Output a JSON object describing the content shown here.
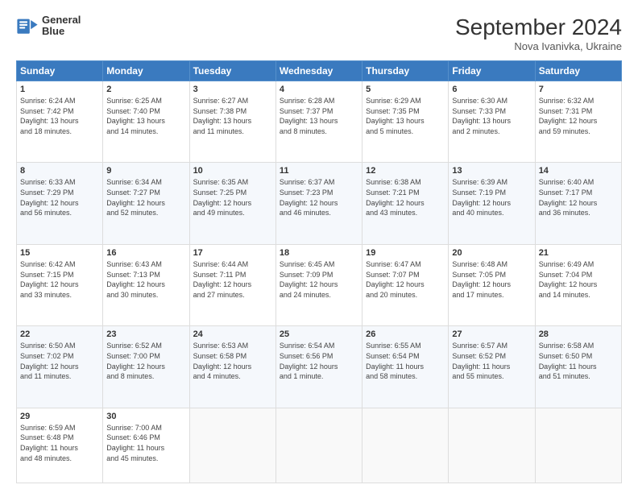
{
  "header": {
    "logo_line1": "General",
    "logo_line2": "Blue",
    "month": "September 2024",
    "location": "Nova Ivanivka, Ukraine"
  },
  "days_of_week": [
    "Sunday",
    "Monday",
    "Tuesday",
    "Wednesday",
    "Thursday",
    "Friday",
    "Saturday"
  ],
  "weeks": [
    [
      {
        "day": 1,
        "info": "Sunrise: 6:24 AM\nSunset: 7:42 PM\nDaylight: 13 hours\nand 18 minutes."
      },
      {
        "day": 2,
        "info": "Sunrise: 6:25 AM\nSunset: 7:40 PM\nDaylight: 13 hours\nand 14 minutes."
      },
      {
        "day": 3,
        "info": "Sunrise: 6:27 AM\nSunset: 7:38 PM\nDaylight: 13 hours\nand 11 minutes."
      },
      {
        "day": 4,
        "info": "Sunrise: 6:28 AM\nSunset: 7:37 PM\nDaylight: 13 hours\nand 8 minutes."
      },
      {
        "day": 5,
        "info": "Sunrise: 6:29 AM\nSunset: 7:35 PM\nDaylight: 13 hours\nand 5 minutes."
      },
      {
        "day": 6,
        "info": "Sunrise: 6:30 AM\nSunset: 7:33 PM\nDaylight: 13 hours\nand 2 minutes."
      },
      {
        "day": 7,
        "info": "Sunrise: 6:32 AM\nSunset: 7:31 PM\nDaylight: 12 hours\nand 59 minutes."
      }
    ],
    [
      {
        "day": 8,
        "info": "Sunrise: 6:33 AM\nSunset: 7:29 PM\nDaylight: 12 hours\nand 56 minutes."
      },
      {
        "day": 9,
        "info": "Sunrise: 6:34 AM\nSunset: 7:27 PM\nDaylight: 12 hours\nand 52 minutes."
      },
      {
        "day": 10,
        "info": "Sunrise: 6:35 AM\nSunset: 7:25 PM\nDaylight: 12 hours\nand 49 minutes."
      },
      {
        "day": 11,
        "info": "Sunrise: 6:37 AM\nSunset: 7:23 PM\nDaylight: 12 hours\nand 46 minutes."
      },
      {
        "day": 12,
        "info": "Sunrise: 6:38 AM\nSunset: 7:21 PM\nDaylight: 12 hours\nand 43 minutes."
      },
      {
        "day": 13,
        "info": "Sunrise: 6:39 AM\nSunset: 7:19 PM\nDaylight: 12 hours\nand 40 minutes."
      },
      {
        "day": 14,
        "info": "Sunrise: 6:40 AM\nSunset: 7:17 PM\nDaylight: 12 hours\nand 36 minutes."
      }
    ],
    [
      {
        "day": 15,
        "info": "Sunrise: 6:42 AM\nSunset: 7:15 PM\nDaylight: 12 hours\nand 33 minutes."
      },
      {
        "day": 16,
        "info": "Sunrise: 6:43 AM\nSunset: 7:13 PM\nDaylight: 12 hours\nand 30 minutes."
      },
      {
        "day": 17,
        "info": "Sunrise: 6:44 AM\nSunset: 7:11 PM\nDaylight: 12 hours\nand 27 minutes."
      },
      {
        "day": 18,
        "info": "Sunrise: 6:45 AM\nSunset: 7:09 PM\nDaylight: 12 hours\nand 24 minutes."
      },
      {
        "day": 19,
        "info": "Sunrise: 6:47 AM\nSunset: 7:07 PM\nDaylight: 12 hours\nand 20 minutes."
      },
      {
        "day": 20,
        "info": "Sunrise: 6:48 AM\nSunset: 7:05 PM\nDaylight: 12 hours\nand 17 minutes."
      },
      {
        "day": 21,
        "info": "Sunrise: 6:49 AM\nSunset: 7:04 PM\nDaylight: 12 hours\nand 14 minutes."
      }
    ],
    [
      {
        "day": 22,
        "info": "Sunrise: 6:50 AM\nSunset: 7:02 PM\nDaylight: 12 hours\nand 11 minutes."
      },
      {
        "day": 23,
        "info": "Sunrise: 6:52 AM\nSunset: 7:00 PM\nDaylight: 12 hours\nand 8 minutes."
      },
      {
        "day": 24,
        "info": "Sunrise: 6:53 AM\nSunset: 6:58 PM\nDaylight: 12 hours\nand 4 minutes."
      },
      {
        "day": 25,
        "info": "Sunrise: 6:54 AM\nSunset: 6:56 PM\nDaylight: 12 hours\nand 1 minute."
      },
      {
        "day": 26,
        "info": "Sunrise: 6:55 AM\nSunset: 6:54 PM\nDaylight: 11 hours\nand 58 minutes."
      },
      {
        "day": 27,
        "info": "Sunrise: 6:57 AM\nSunset: 6:52 PM\nDaylight: 11 hours\nand 55 minutes."
      },
      {
        "day": 28,
        "info": "Sunrise: 6:58 AM\nSunset: 6:50 PM\nDaylight: 11 hours\nand 51 minutes."
      }
    ],
    [
      {
        "day": 29,
        "info": "Sunrise: 6:59 AM\nSunset: 6:48 PM\nDaylight: 11 hours\nand 48 minutes."
      },
      {
        "day": 30,
        "info": "Sunrise: 7:00 AM\nSunset: 6:46 PM\nDaylight: 11 hours\nand 45 minutes."
      },
      null,
      null,
      null,
      null,
      null
    ]
  ]
}
